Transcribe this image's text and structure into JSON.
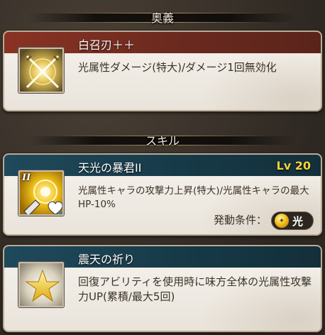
{
  "sections": {
    "ougi": {
      "header": "奥義"
    },
    "skill": {
      "header": "スキル"
    }
  },
  "ougi": {
    "name": "白召刃＋＋",
    "description": "光属性ダメージ(特大)/ダメージ1回無効化",
    "icon": "crossed-swords-icon"
  },
  "skills": [
    {
      "name": "天光の暴君II",
      "level": "Lv 20",
      "description": "光属性キャラの攻撃力上昇(特大)/光属性キャラの最大HP-10%",
      "icon": "sun-shield-icon",
      "icon_badge": "II",
      "condition_label": "発動条件：",
      "condition_value": "光"
    },
    {
      "name": "震天の祈り",
      "description": "回復アビリティを使用時に味方全体の光属性攻撃力UP(累積/最大5回)",
      "icon": "star-icon"
    }
  ],
  "colors": {
    "ougi_title_bar": "#8a3324",
    "skill_title_bar": "#1f4a5c",
    "level_text": "#f5d234",
    "light_element": "#f1c01c"
  }
}
